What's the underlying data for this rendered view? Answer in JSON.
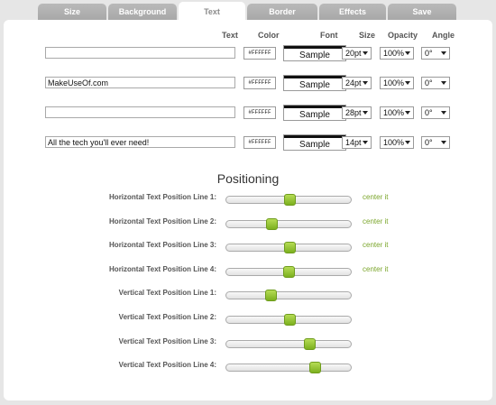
{
  "tabs": [
    {
      "label": "Size",
      "active": false
    },
    {
      "label": "Background",
      "active": false
    },
    {
      "label": "Text",
      "active": true
    },
    {
      "label": "Border",
      "active": false
    },
    {
      "label": "Effects",
      "active": false
    },
    {
      "label": "Save",
      "active": false
    }
  ],
  "headers": {
    "text": "Text",
    "color": "Color",
    "font": "Font",
    "size": "Size",
    "opacity": "Opacity",
    "angle": "Angle"
  },
  "text_lines": [
    {
      "text": "",
      "color": "#FFFFFF",
      "font_sample": "Sample",
      "size": "20pt",
      "opacity": "100%",
      "angle": "0°"
    },
    {
      "text": "MakeUseOf.com",
      "color": "#FFFFFF",
      "font_sample": "Sample",
      "size": "24pt",
      "opacity": "100%",
      "angle": "0°"
    },
    {
      "text": "",
      "color": "#FFFFFF",
      "font_sample": "Sample",
      "size": "28pt",
      "opacity": "100%",
      "angle": "0°"
    },
    {
      "text": "All the tech you'll ever need!",
      "color": "#FFFFFF",
      "font_sample": "Sample",
      "size": "14pt",
      "opacity": "100%",
      "angle": "0°"
    }
  ],
  "positioning": {
    "title": "Positioning",
    "center_label": "center it",
    "sliders": [
      {
        "label": "Horizontal Text Position Line 1:",
        "value": 0.5,
        "center_link": true
      },
      {
        "label": "Horizontal Text Position Line 2:",
        "value": 0.36,
        "center_link": true
      },
      {
        "label": "Horizontal Text Position Line 3:",
        "value": 0.5,
        "center_link": true
      },
      {
        "label": "Horizontal Text Position Line 4:",
        "value": 0.49,
        "center_link": true
      },
      {
        "label": "Vertical Text Position Line 1:",
        "value": 0.35,
        "center_link": false
      },
      {
        "label": "Vertical Text Position Line 2:",
        "value": 0.5,
        "center_link": false
      },
      {
        "label": "Vertical Text Position Line 3:",
        "value": 0.66,
        "center_link": false
      },
      {
        "label": "Vertical Text Position Line 4:",
        "value": 0.7,
        "center_link": false
      }
    ]
  },
  "colors": {
    "accent": "#7AA52A",
    "slider_handle": "#9CCB3B",
    "tab_inactive": "#B0B0B0"
  }
}
